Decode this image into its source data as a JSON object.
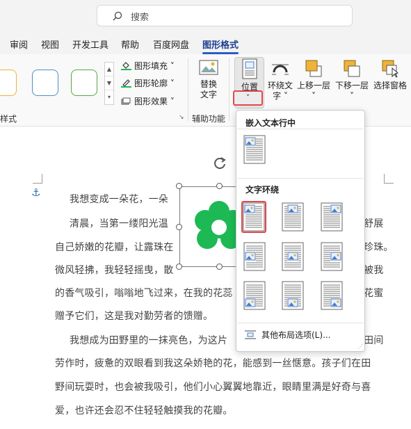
{
  "search": {
    "placeholder": "搜索"
  },
  "tabs": [
    "审阅",
    "视图",
    "开发工具",
    "帮助",
    "百度网盘",
    "图形格式"
  ],
  "ribbon": {
    "style_group": {
      "label": "样式"
    },
    "fill": "图形填充",
    "outline": "图形轮廓",
    "effect": "图形效果",
    "alt_text": {
      "line1": "替换",
      "line2": "文字"
    },
    "accessibility_label": "辅助功能",
    "position": "位置",
    "wrap_text": {
      "line1": "环绕文",
      "line2": "字"
    },
    "bring_forward": "上移一层",
    "send_backward": "下移一层",
    "selection_pane": "选择窗格"
  },
  "colors": {
    "accent": "#1f3f8f",
    "highlight_red": "#e0474c",
    "flower_green": "#1db954",
    "shape_orange": "#f0b23a",
    "shape_blue": "#4a90c8",
    "shape_green": "#5aa544"
  },
  "menu": {
    "inline_header": "嵌入文本行中",
    "wrap_header": "文字环绕",
    "more_options": "其他布局选项(L)..."
  },
  "document": {
    "lines": [
      "我想变成一朵花，一朵",
      "清晨，当第一缕阳光温",
      "舒展",
      "自己娇嫩的花瓣，让露珠在",
      "珍珠。",
      "微风轻拂，我轻轻摇曳，散",
      "被我",
      "的香气吸引，嗡嗡地飞过来，在我的花蕊",
      "花蜜",
      "赠予它们，这是我对勤劳者的馈赠。",
      "我想成为田野里的一抹亮色，为这片",
      "田间",
      "劳作时，疲惫的双眼看到我这朵娇艳的花，能感到一丝惬意。孩子们在田",
      "野间玩耍时，也会被我吸引，他们小心翼翼地靠近，眼睛里满是好奇与喜",
      "爱，也许还会忍不住轻轻触摸我的花瓣。"
    ]
  }
}
